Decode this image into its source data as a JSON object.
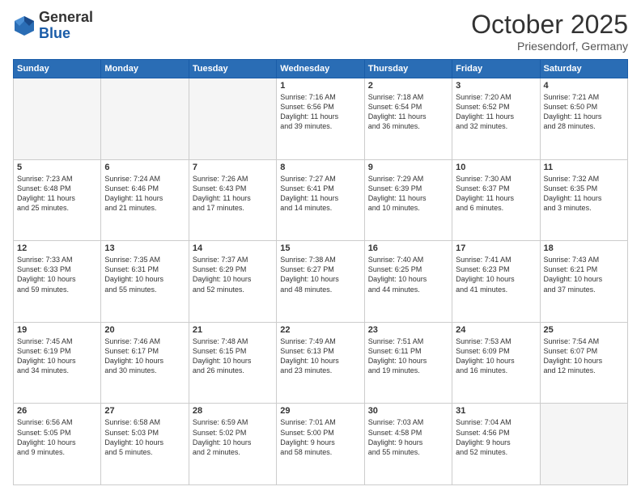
{
  "header": {
    "logo": {
      "general": "General",
      "blue": "Blue"
    },
    "title": "October 2025",
    "subtitle": "Priesendorf, Germany"
  },
  "calendar": {
    "days_of_week": [
      "Sunday",
      "Monday",
      "Tuesday",
      "Wednesday",
      "Thursday",
      "Friday",
      "Saturday"
    ],
    "weeks": [
      [
        {
          "day": "",
          "info": ""
        },
        {
          "day": "",
          "info": ""
        },
        {
          "day": "",
          "info": ""
        },
        {
          "day": "1",
          "info": "Sunrise: 7:16 AM\nSunset: 6:56 PM\nDaylight: 11 hours\nand 39 minutes."
        },
        {
          "day": "2",
          "info": "Sunrise: 7:18 AM\nSunset: 6:54 PM\nDaylight: 11 hours\nand 36 minutes."
        },
        {
          "day": "3",
          "info": "Sunrise: 7:20 AM\nSunset: 6:52 PM\nDaylight: 11 hours\nand 32 minutes."
        },
        {
          "day": "4",
          "info": "Sunrise: 7:21 AM\nSunset: 6:50 PM\nDaylight: 11 hours\nand 28 minutes."
        }
      ],
      [
        {
          "day": "5",
          "info": "Sunrise: 7:23 AM\nSunset: 6:48 PM\nDaylight: 11 hours\nand 25 minutes."
        },
        {
          "day": "6",
          "info": "Sunrise: 7:24 AM\nSunset: 6:46 PM\nDaylight: 11 hours\nand 21 minutes."
        },
        {
          "day": "7",
          "info": "Sunrise: 7:26 AM\nSunset: 6:43 PM\nDaylight: 11 hours\nand 17 minutes."
        },
        {
          "day": "8",
          "info": "Sunrise: 7:27 AM\nSunset: 6:41 PM\nDaylight: 11 hours\nand 14 minutes."
        },
        {
          "day": "9",
          "info": "Sunrise: 7:29 AM\nSunset: 6:39 PM\nDaylight: 11 hours\nand 10 minutes."
        },
        {
          "day": "10",
          "info": "Sunrise: 7:30 AM\nSunset: 6:37 PM\nDaylight: 11 hours\nand 6 minutes."
        },
        {
          "day": "11",
          "info": "Sunrise: 7:32 AM\nSunset: 6:35 PM\nDaylight: 11 hours\nand 3 minutes."
        }
      ],
      [
        {
          "day": "12",
          "info": "Sunrise: 7:33 AM\nSunset: 6:33 PM\nDaylight: 10 hours\nand 59 minutes."
        },
        {
          "day": "13",
          "info": "Sunrise: 7:35 AM\nSunset: 6:31 PM\nDaylight: 10 hours\nand 55 minutes."
        },
        {
          "day": "14",
          "info": "Sunrise: 7:37 AM\nSunset: 6:29 PM\nDaylight: 10 hours\nand 52 minutes."
        },
        {
          "day": "15",
          "info": "Sunrise: 7:38 AM\nSunset: 6:27 PM\nDaylight: 10 hours\nand 48 minutes."
        },
        {
          "day": "16",
          "info": "Sunrise: 7:40 AM\nSunset: 6:25 PM\nDaylight: 10 hours\nand 44 minutes."
        },
        {
          "day": "17",
          "info": "Sunrise: 7:41 AM\nSunset: 6:23 PM\nDaylight: 10 hours\nand 41 minutes."
        },
        {
          "day": "18",
          "info": "Sunrise: 7:43 AM\nSunset: 6:21 PM\nDaylight: 10 hours\nand 37 minutes."
        }
      ],
      [
        {
          "day": "19",
          "info": "Sunrise: 7:45 AM\nSunset: 6:19 PM\nDaylight: 10 hours\nand 34 minutes."
        },
        {
          "day": "20",
          "info": "Sunrise: 7:46 AM\nSunset: 6:17 PM\nDaylight: 10 hours\nand 30 minutes."
        },
        {
          "day": "21",
          "info": "Sunrise: 7:48 AM\nSunset: 6:15 PM\nDaylight: 10 hours\nand 26 minutes."
        },
        {
          "day": "22",
          "info": "Sunrise: 7:49 AM\nSunset: 6:13 PM\nDaylight: 10 hours\nand 23 minutes."
        },
        {
          "day": "23",
          "info": "Sunrise: 7:51 AM\nSunset: 6:11 PM\nDaylight: 10 hours\nand 19 minutes."
        },
        {
          "day": "24",
          "info": "Sunrise: 7:53 AM\nSunset: 6:09 PM\nDaylight: 10 hours\nand 16 minutes."
        },
        {
          "day": "25",
          "info": "Sunrise: 7:54 AM\nSunset: 6:07 PM\nDaylight: 10 hours\nand 12 minutes."
        }
      ],
      [
        {
          "day": "26",
          "info": "Sunrise: 6:56 AM\nSunset: 5:05 PM\nDaylight: 10 hours\nand 9 minutes."
        },
        {
          "day": "27",
          "info": "Sunrise: 6:58 AM\nSunset: 5:03 PM\nDaylight: 10 hours\nand 5 minutes."
        },
        {
          "day": "28",
          "info": "Sunrise: 6:59 AM\nSunset: 5:02 PM\nDaylight: 10 hours\nand 2 minutes."
        },
        {
          "day": "29",
          "info": "Sunrise: 7:01 AM\nSunset: 5:00 PM\nDaylight: 9 hours\nand 58 minutes."
        },
        {
          "day": "30",
          "info": "Sunrise: 7:03 AM\nSunset: 4:58 PM\nDaylight: 9 hours\nand 55 minutes."
        },
        {
          "day": "31",
          "info": "Sunrise: 7:04 AM\nSunset: 4:56 PM\nDaylight: 9 hours\nand 52 minutes."
        },
        {
          "day": "",
          "info": ""
        }
      ]
    ]
  }
}
